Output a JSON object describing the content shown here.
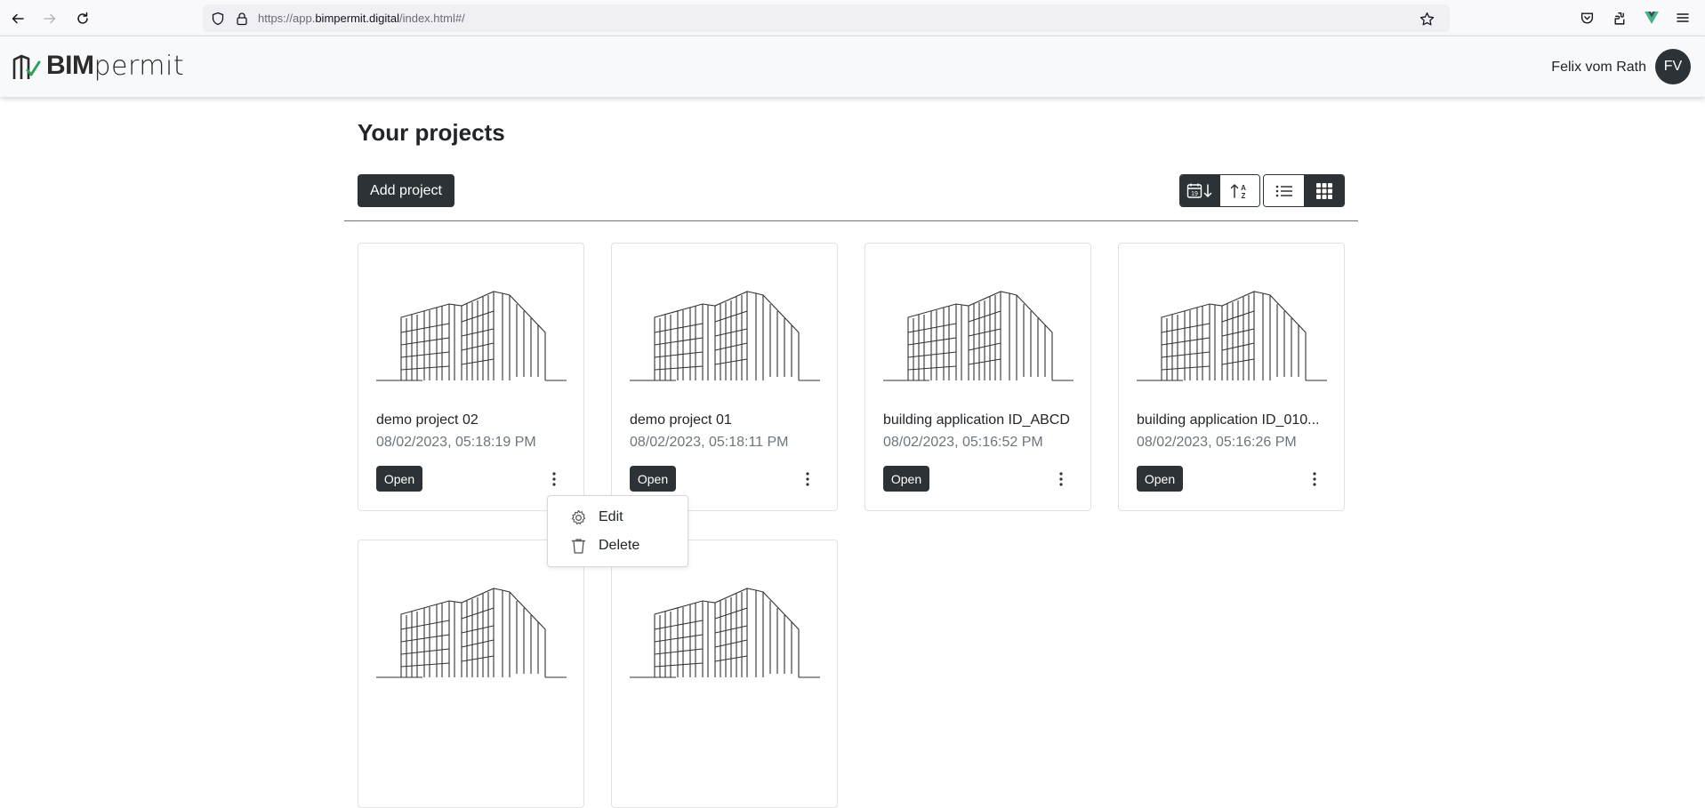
{
  "browser": {
    "url_prefix": "https://app.",
    "url_domain": "bimpermit.digital",
    "url_path": "/index.html#/",
    "icons": [
      "back-icon",
      "forward-icon",
      "reload-icon",
      "shield-icon",
      "lock-icon",
      "bookmark-star-icon",
      "pocket-icon",
      "extensions-icon",
      "vue-devtools-icon",
      "menu-icon"
    ]
  },
  "header": {
    "logo_bold": "BIM",
    "logo_light": "permit",
    "user_name": "Felix vom Rath",
    "avatar_initials": "FV"
  },
  "main": {
    "title": "Your projects",
    "add_button": "Add project",
    "toolbar": {
      "sort_date_icon": "calendar-sort-icon",
      "sort_alpha_icon": "sort-alpha-icon",
      "list_view_icon": "list-view-icon",
      "grid_view_icon": "grid-view-icon",
      "active_view": "grid"
    },
    "projects": [
      {
        "name": "demo project 02",
        "date": "08/02/2023, 05:18:19 PM",
        "open_label": "Open"
      },
      {
        "name": "demo project 01",
        "date": "08/02/2023, 05:18:11 PM",
        "open_label": "Open"
      },
      {
        "name": "building application ID_ABCD",
        "date": "08/02/2023, 05:16:52 PM",
        "open_label": "Open"
      },
      {
        "name": "building application ID_010...",
        "date": "08/02/2023, 05:16:26 PM",
        "open_label": "Open"
      }
    ],
    "context_menu": {
      "items": [
        {
          "label": "Edit",
          "icon": "gear-icon"
        },
        {
          "label": "Delete",
          "icon": "trash-icon"
        }
      ]
    }
  },
  "colors": {
    "primary_dark": "#2c3236",
    "muted_text": "#6c757d",
    "logo_check_green": "#2e9e5b"
  }
}
